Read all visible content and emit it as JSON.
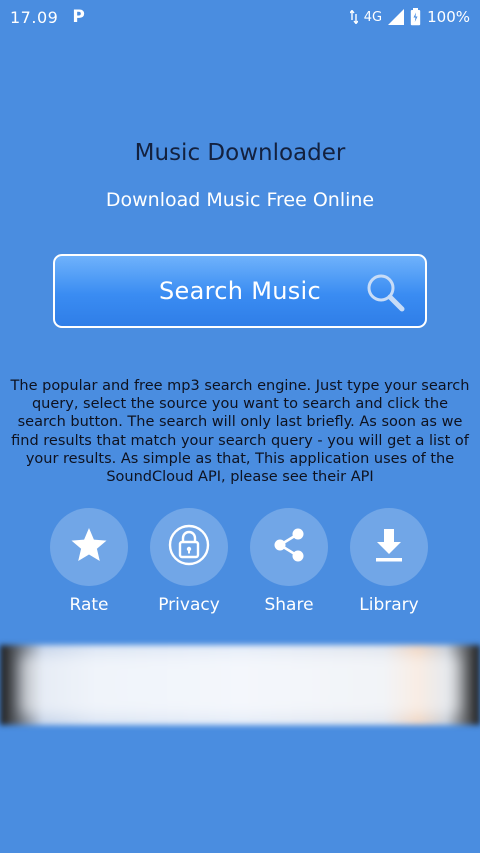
{
  "status_bar": {
    "time": "17.09",
    "notification_icon": "P",
    "network": "4G",
    "battery": "100%"
  },
  "app": {
    "title": "Music Downloader",
    "subtitle": "Download Music Free Online"
  },
  "search": {
    "label": "Search Music"
  },
  "description": "The popular and free mp3 search engine. Just type your search query, select the source you want to search and click the search button. The search will only last briefly. As soon as we find results that match your search query - you will get a list of your results. As simple as that, This application uses of the SoundCloud API, please see their API",
  "actions": [
    {
      "label": "Rate",
      "icon": "star-icon"
    },
    {
      "label": "Privacy",
      "icon": "lock-icon"
    },
    {
      "label": "Share",
      "icon": "share-icon"
    },
    {
      "label": "Library",
      "icon": "download-icon"
    }
  ],
  "colors": {
    "background": "#4a8de0",
    "title": "#13213f",
    "description": "#0e1220",
    "button_top": "#6fb2fb",
    "button_bottom": "#2f7ee8"
  }
}
